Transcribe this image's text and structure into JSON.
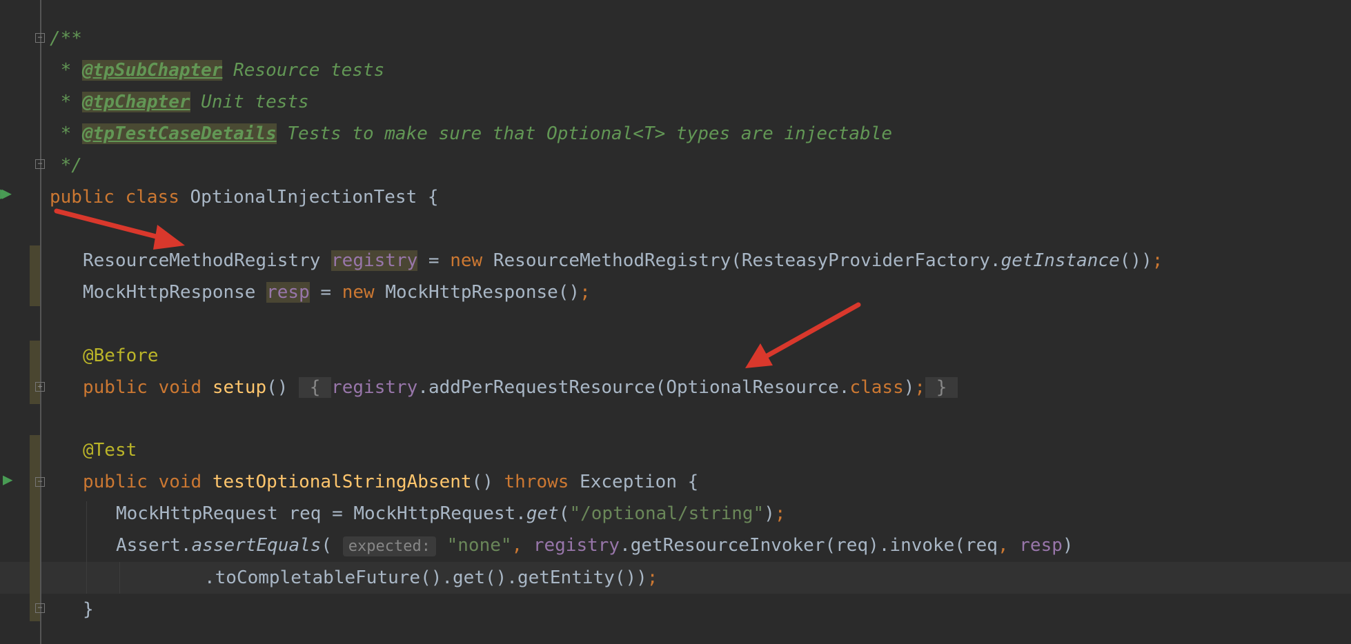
{
  "editor": {
    "language": "Java",
    "theme_background": "#2b2b2b",
    "gutter_icons": [
      "run-class-icon",
      "run-test-icon"
    ],
    "annotation_arrow_color": "#d9382c",
    "lines": {
      "doc_open": "/**",
      "doc_l1": {
        "prefix": " * ",
        "tag": "@tpSubChapter",
        "text": " Resource tests"
      },
      "doc_l2": {
        "prefix": " * ",
        "tag": "@tpChapter",
        "text": " Unit tests"
      },
      "doc_l3": {
        "prefix": " * ",
        "tag": "@tpTestCaseDetails",
        "text": " Tests to make sure that Optional<T> types are injectable"
      },
      "doc_close": " */",
      "class_decl": {
        "kw1": "public",
        "kw2": "class",
        "name": "OptionalInjectionTest",
        "brace": "{"
      },
      "field1": {
        "type": "ResourceMethodRegistry",
        "name": "registry",
        "assign": "=",
        "new_kw": "new",
        "ctor": "ResourceMethodRegistry(ResteasyProviderFactory.",
        "method": "getInstance",
        "tail": "())",
        "semi": ";"
      },
      "field2": {
        "type": "MockHttpResponse",
        "name": "resp",
        "assign": "=",
        "new_kw": "new",
        "ctor": "MockHttpResponse()",
        "semi": ";"
      },
      "before_ann": "@Before",
      "setup": {
        "kw1": "public",
        "kw2": "void",
        "name": "setup",
        "parens": "()",
        "open": "{",
        "field": "registry",
        "call": ".addPerRequestResource(OptionalResource.",
        "class_kw": "class",
        "close_paren": ")",
        "semi": ";",
        "close": "}"
      },
      "test_ann": "@Test",
      "test_decl": {
        "kw1": "public",
        "kw2": "void",
        "name": "testOptionalStringAbsent",
        "parens": "()",
        "throws_kw": "throws",
        "exc": "Exception",
        "brace": "{"
      },
      "req_line": {
        "decl": "MockHttpRequest req = MockHttpRequest.",
        "method": "get",
        "open": "(",
        "str": "\"/optional/string\"",
        "close": ")",
        "semi": ";"
      },
      "assert_line": {
        "cls": "Assert.",
        "method": "assertEquals",
        "open": "(",
        "hint": "expected:",
        "str": "\"none\"",
        "comma": ",",
        "field": "registry",
        "call": ".getResourceInvoker(req).invoke(req",
        "comma2": ",",
        "field2": "resp",
        "close": ")"
      },
      "chain_line": {
        "text": ".toCompletableFuture().get().getEntity())",
        "semi": ";"
      },
      "method_close": "}"
    }
  }
}
